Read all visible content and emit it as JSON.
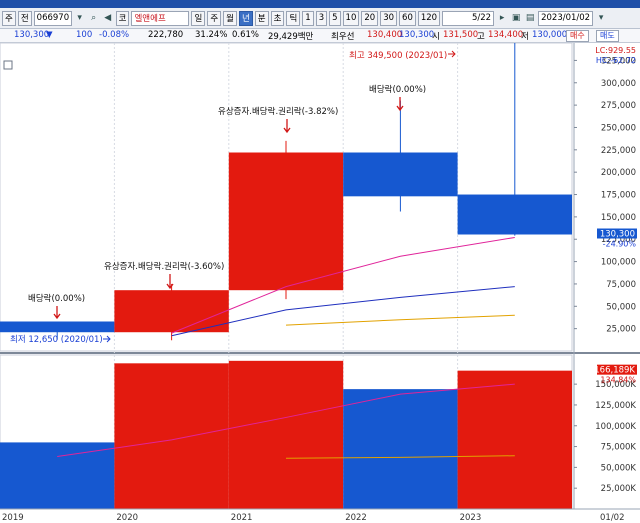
{
  "toolbar": {
    "market": "주",
    "prev": "전",
    "code": "066970",
    "code_btn": "코",
    "name": "엘앤에프",
    "periods": [
      "일",
      "주",
      "월",
      "년",
      "분",
      "초",
      "틱"
    ],
    "period_selected": "년",
    "intervals": [
      "1",
      "3",
      "5",
      "10",
      "20",
      "30",
      "60",
      "120"
    ],
    "page": "5/22",
    "date": "2023/01/02"
  },
  "quote": {
    "price": "130,300",
    "change": "100",
    "change_pct": "-0.08%",
    "volume": "222,780",
    "volume_ratio": "31.24%",
    "turnover": "0.61%",
    "amount": "29,429백만",
    "prio_label": "최우선",
    "ask": "130,400",
    "bid": "130,300",
    "open_label": "시",
    "open": "131,500",
    "high_label": "고",
    "high": "134,400",
    "low_label": "저",
    "low": "130,000",
    "buy_label": "매수",
    "sell_label": "매도"
  },
  "colors": {
    "up": "#e31a0f",
    "down": "#1658d0",
    "ma5": "#e0249a",
    "ma10": "#1f2fbe",
    "ma20": "#e2a200"
  },
  "chart_data": {
    "type": "candlestick",
    "x": [
      "2019",
      "2020",
      "2021",
      "2022",
      "2023"
    ],
    "candles": [
      {
        "open": 33000,
        "high": 33000,
        "low": 12650,
        "close": 21000
      },
      {
        "open": 21000,
        "high": 75000,
        "low": 12000,
        "close": 68000
      },
      {
        "open": 68000,
        "high": 235000,
        "low": 58000,
        "close": 222000
      },
      {
        "open": 222000,
        "high": 280000,
        "low": 156000,
        "close": 173000
      },
      {
        "open": 175000,
        "high": 349500,
        "low": 129000,
        "close": 130300
      }
    ],
    "ma_lines": [
      {
        "color": "#e0249a",
        "values": [
          null,
          20000,
          72000,
          106000,
          127000
        ]
      },
      {
        "color": "#1f2fbe",
        "values": [
          null,
          17000,
          46000,
          60000,
          72000
        ]
      },
      {
        "color": "#e2a200",
        "values": [
          null,
          null,
          29000,
          35000,
          40000
        ]
      }
    ],
    "price_axis": {
      "min": 0,
      "max": 340000,
      "ticks": [
        "25,000",
        "50,000",
        "75,000",
        "100,000",
        "125,000",
        "150,000",
        "175,000",
        "200,000",
        "225,000",
        "250,000",
        "275,000",
        "300,000",
        "325,000"
      ]
    },
    "volume": [
      {
        "value": 80000,
        "color": "#1658d0"
      },
      {
        "value": 175000,
        "color": "#e31a0f"
      },
      {
        "value": 178000,
        "color": "#e31a0f"
      },
      {
        "value": 144000,
        "color": "#1658d0"
      },
      {
        "value": 166189,
        "color": "#e31a0f"
      }
    ],
    "volume_ma": [
      {
        "color": "#e0249a",
        "values": [
          63000,
          83000,
          110000,
          138000,
          150000
        ]
      },
      {
        "color": "#e2a200",
        "values": [
          null,
          null,
          61000,
          62000,
          64000
        ]
      }
    ],
    "volume_axis": {
      "min": 0,
      "max": 185000,
      "ticks": [
        "25,000K",
        "50,000K",
        "75,000K",
        "100,000K",
        "125,000K",
        "150,000K"
      ]
    },
    "annotations": {
      "max_label": "최고 349,500 (2023/01)",
      "min_label": "최저 12,650 (2020/01)",
      "events": [
        "배당락(0.00%)",
        "유상증자.배당락.권리락(-3.60%)",
        "유상증자.배당락.권리락(-3.82%)",
        "배당락(0.00%)"
      ],
      "lc": "LC:929.55",
      "hc": "HC:-62.72",
      "price_tag": "130,300",
      "price_tag_pct": "-24.90%",
      "vol_tag": "166,189K",
      "vol_tag_pct": "134.84%"
    },
    "x_end_label": "01/02"
  }
}
